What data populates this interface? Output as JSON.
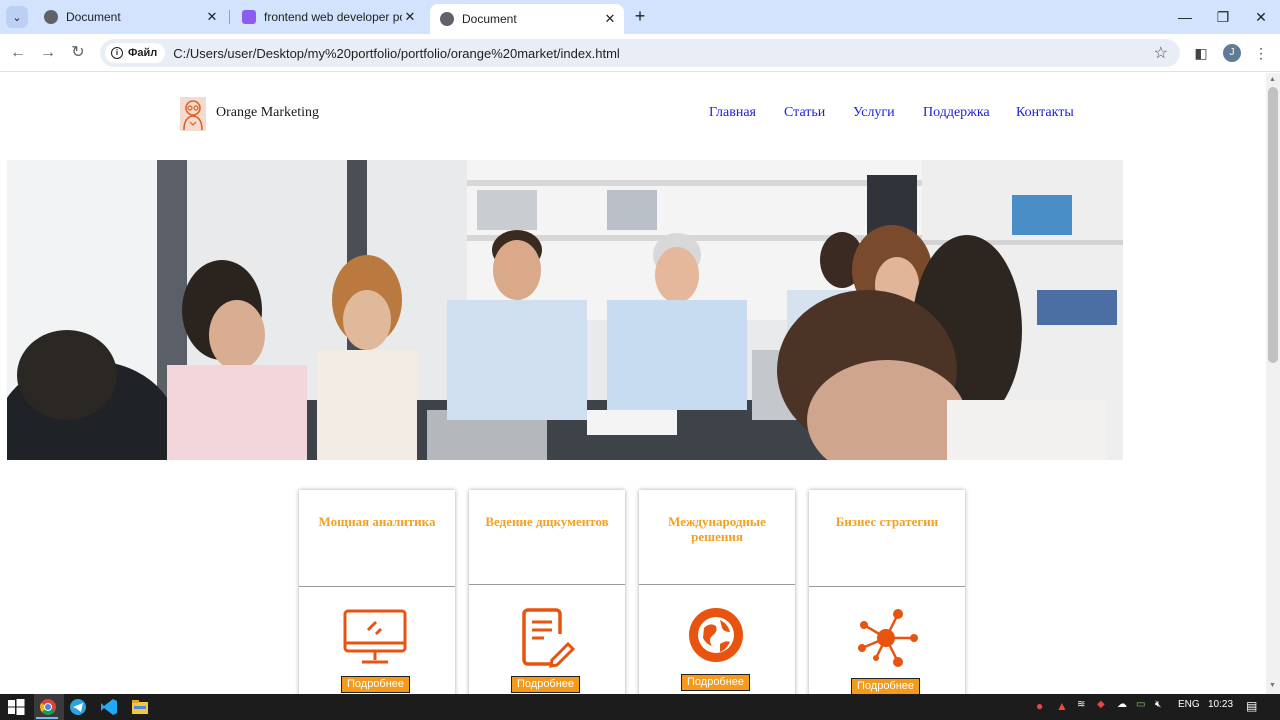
{
  "browser": {
    "tabs": [
      {
        "title": "Document",
        "active": false
      },
      {
        "title": "frontend web developer portfolio",
        "active": false
      },
      {
        "title": "Document",
        "active": true
      }
    ],
    "chip_label": "Файл",
    "url": "C:/Users/user/Desktop/my%20portfolio/portfolio/orange%20market/index.html",
    "profile_initial": "J"
  },
  "site": {
    "brand": "Orange Marketing",
    "nav": [
      "Главная",
      "Статьи",
      "Услуги",
      "Поддержка",
      "Контакты"
    ],
    "cards": [
      {
        "title": "Мощная аналитика",
        "icon": "monitor-icon",
        "button": "Подробнее"
      },
      {
        "title": "Ведение дщкументов",
        "icon": "document-edit-icon",
        "button": "Подробнее"
      },
      {
        "title": "Международные решения",
        "icon": "globe-icon",
        "button": "Подробнее"
      },
      {
        "title": "Бизнес стратегии",
        "icon": "network-hub-icon",
        "button": "Подробнее"
      }
    ],
    "accent_color": "#f5a020",
    "icon_color": "#e8530f",
    "link_color": "#1d1de0"
  },
  "taskbar": {
    "language": "ENG",
    "time": "10:23"
  }
}
